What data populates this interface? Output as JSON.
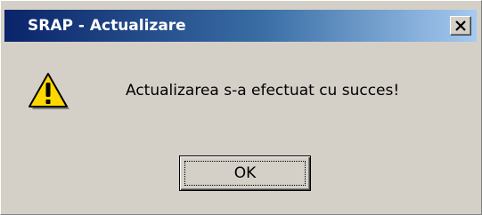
{
  "window": {
    "title": "SRAP - Actualizare",
    "close_icon": "close-x-icon"
  },
  "dialog": {
    "icon": "warning-icon",
    "message": "Actualizarea s-a efectuat cu succes!",
    "ok_label": "OK"
  },
  "colors": {
    "title_gradient_start": "#0a246a",
    "title_gradient_end": "#a6caf0",
    "dialog_background": "#d4d0c8",
    "warning_yellow": "#ffd800"
  }
}
